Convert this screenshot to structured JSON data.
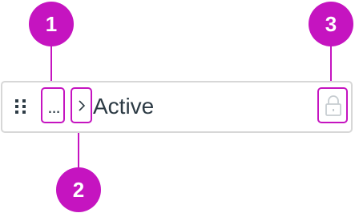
{
  "row": {
    "title": "Active",
    "more_label": "...",
    "drag_icon": "drag-handle-icon",
    "expand_icon": "chevron-right-icon",
    "lock_icon": "lock-icon"
  },
  "callouts": [
    {
      "number": "1"
    },
    {
      "number": "2"
    },
    {
      "number": "3"
    }
  ],
  "colors": {
    "accent": "#c514c0",
    "text": "#2d3b45",
    "border": "#d7d7d7",
    "icon_muted": "#c7cdd1"
  }
}
